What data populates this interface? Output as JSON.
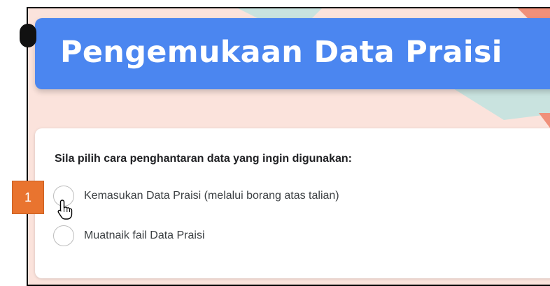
{
  "form": {
    "title": "Pengemukaan Data Praisi",
    "question": "Sila pilih cara penghantaran data yang ingin digunakan:",
    "options": [
      {
        "label": "Kemasukan Data Praisi (melalui borang atas talian)",
        "selected": false
      },
      {
        "label": "Muatnaik fail Data Praisi",
        "selected": false
      }
    ]
  },
  "annotation": {
    "step_label": "1",
    "color": "#e9742f"
  },
  "theme": {
    "header_color": "#4b86f0",
    "background_color": "#fbe3dc",
    "accent_teal": "#c9e3df",
    "accent_coral": "#f0907a"
  },
  "icons": {
    "cursor": "hand-pointer-icon"
  }
}
